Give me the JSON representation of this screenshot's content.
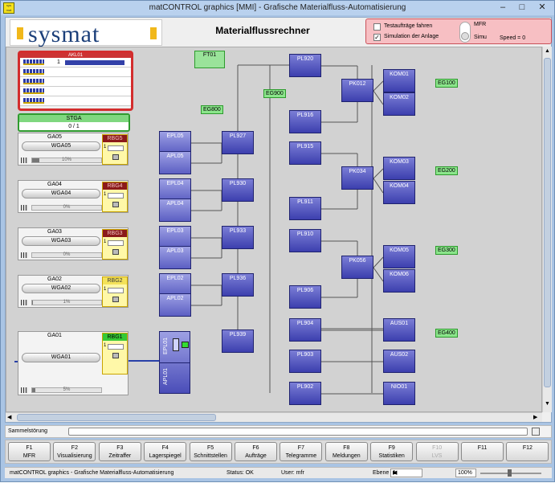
{
  "window": {
    "title": "matCONTROL graphics [MMI]  - Grafische Materialfluss-Automatisierung",
    "icon_text": "sys mat"
  },
  "header": {
    "logo": "sysmat",
    "page_title": "Materialflussrechner"
  },
  "sim_panel": {
    "test_label": "Testaufträge fahren",
    "test_checked": false,
    "sim_label": "Simulation der Anlage",
    "sim_checked": true,
    "sim_mark": "✓",
    "mfr_label": "MFR",
    "simu_label": "Simu",
    "speed_label": "Speed = 0"
  },
  "canvas": {
    "ft01": "FT01",
    "akl": {
      "title": "AKL01",
      "count": "1"
    },
    "stga": {
      "title": "STGA",
      "value": "0 / 1"
    },
    "ga_blocks": [
      {
        "ga": "GA05",
        "wga": "WGA05",
        "rbg": "RBG5",
        "rbg_state": "error",
        "pct": "10%",
        "fill": 0.1
      },
      {
        "ga": "GA04",
        "wga": "WGA04",
        "rbg": "RBG4",
        "rbg_state": "error",
        "pct": "0%",
        "fill": 0
      },
      {
        "ga": "GA03",
        "wga": "WGA03",
        "rbg": "RBG3",
        "rbg_state": "error",
        "pct": "0%",
        "fill": 0
      },
      {
        "ga": "GA02",
        "wga": "WGA02",
        "rbg": "RBG2",
        "rbg_state": "ok",
        "pct": "1%",
        "fill": 0.01
      },
      {
        "ga": "GA01",
        "wga": "WGA01",
        "rbg": "RBG1",
        "rbg_state": "active",
        "pct": "5%",
        "fill": 0.05
      }
    ],
    "nodes": [
      "EPL05",
      "APL05",
      "EPL04",
      "APL04",
      "EPL03",
      "APL03",
      "EPL02",
      "APL02",
      "PL927",
      "PL930",
      "PL933",
      "PL936",
      "PL939",
      "PL920",
      "PL916",
      "PL915",
      "PL911",
      "PL910",
      "PL906",
      "PL904",
      "PL903",
      "PL902",
      "PK012",
      "PK034",
      "PK056",
      "KOM01",
      "KOM02",
      "KOM03",
      "KOM04",
      "KOM05",
      "KOM06",
      "AUS01",
      "AUS02",
      "NIO01"
    ],
    "epl01": {
      "epl": "EPL01",
      "apl": "APL01"
    },
    "eg": [
      "EG800",
      "EG900",
      "EG100",
      "EG200",
      "EG300",
      "EG400"
    ]
  },
  "bottom": {
    "sammel_label": "Sammelstörung",
    "fkeys": [
      {
        "key": "F1",
        "label": "MFR",
        "enabled": true
      },
      {
        "key": "F2",
        "label": "Visualisierung",
        "enabled": true
      },
      {
        "key": "F3",
        "label": "Zeitraffer",
        "enabled": true
      },
      {
        "key": "F4",
        "label": "Lagerspiegel",
        "enabled": true
      },
      {
        "key": "F5",
        "label": "Schnittstellen",
        "enabled": true
      },
      {
        "key": "F6",
        "label": "Aufträge",
        "enabled": true
      },
      {
        "key": "F7",
        "label": "Telegramme",
        "enabled": true
      },
      {
        "key": "F8",
        "label": "Meldungen",
        "enabled": true
      },
      {
        "key": "F9",
        "label": "Statistiken",
        "enabled": true
      },
      {
        "key": "F10",
        "label": "LVS",
        "enabled": false
      },
      {
        "key": "F11",
        "label": "",
        "enabled": true
      },
      {
        "key": "F12",
        "label": "",
        "enabled": true
      }
    ]
  },
  "status": {
    "app": "matCONTROL graphics - Grafische Materialfluss-Automatisierung",
    "status": "Status: OK",
    "user": "User: mfr",
    "ebene_label": "Ebene",
    "ebene_value": "1",
    "zoom": "100%"
  },
  "colors": {
    "node": "#3c3fae",
    "eg": "#8be58b",
    "error": "#d32d2d",
    "ok": "#35c935"
  }
}
